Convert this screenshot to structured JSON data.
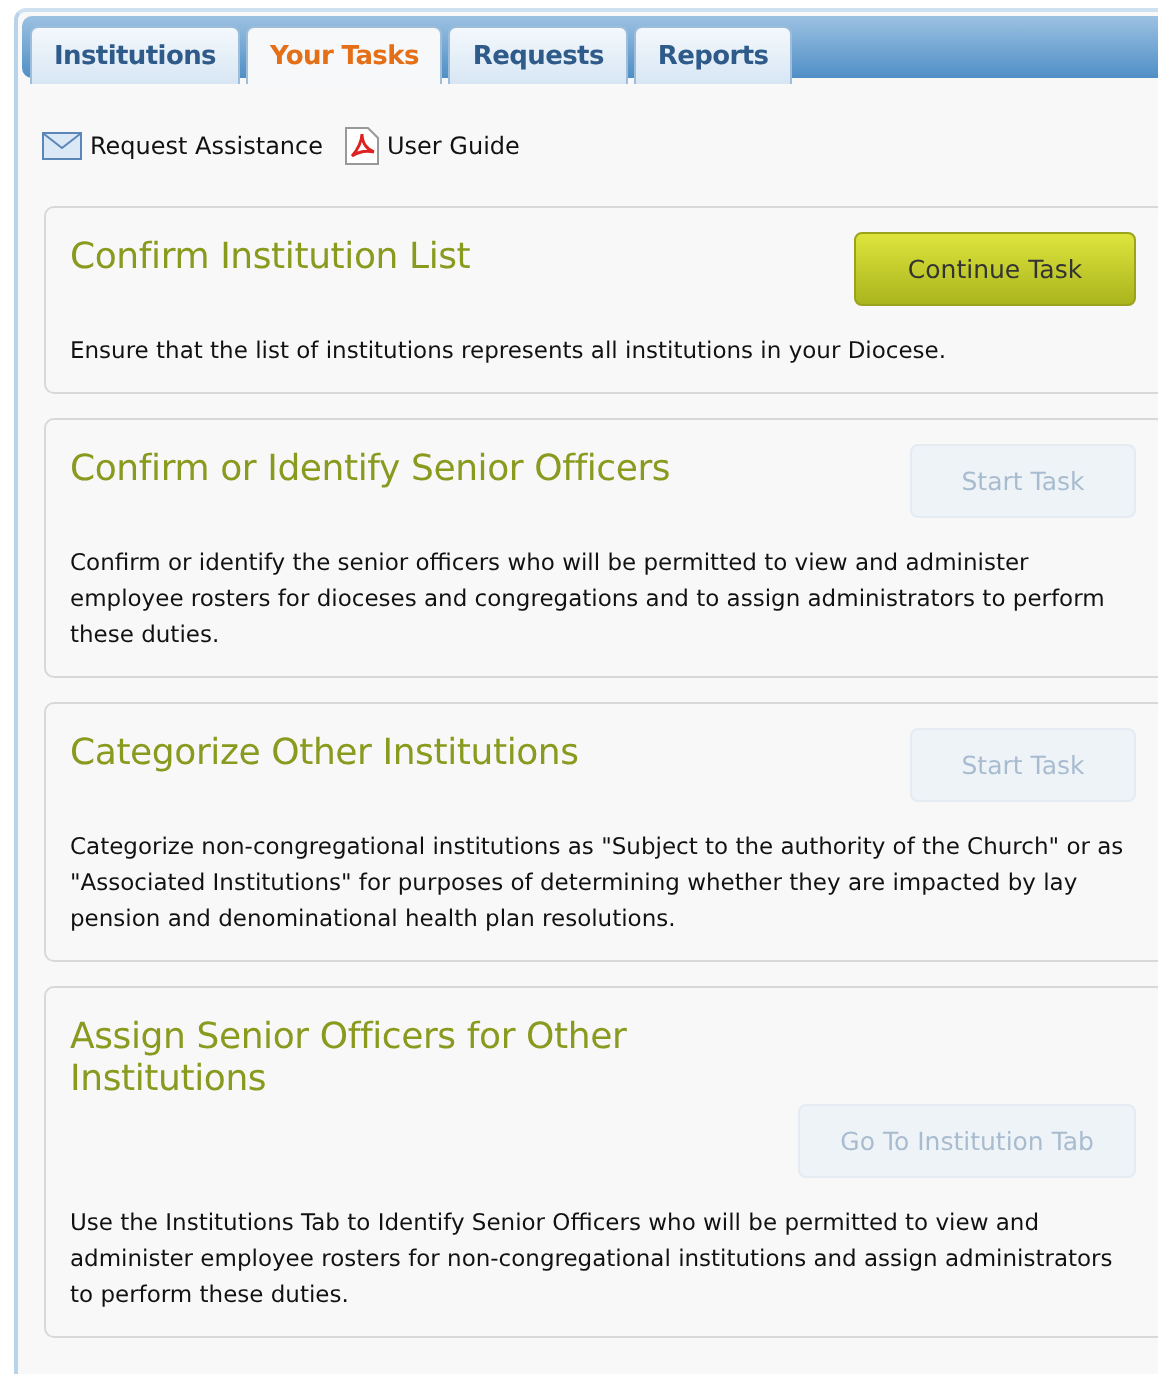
{
  "tabs": [
    {
      "label": "Institutions",
      "selected": false
    },
    {
      "label": "Your Tasks",
      "selected": true
    },
    {
      "label": "Requests",
      "selected": false
    },
    {
      "label": "Reports",
      "selected": false
    }
  ],
  "links": [
    {
      "kind": "mail",
      "label": "Request Assistance"
    },
    {
      "kind": "pdf",
      "label": "User Guide"
    }
  ],
  "tasks": [
    {
      "title": "Confirm Institution List",
      "button": {
        "label": "Continue Task",
        "disabled": false
      },
      "description": "Ensure that the list of institutions represents all institutions in your Diocese."
    },
    {
      "title": "Confirm or Identify Senior Officers",
      "button": {
        "label": "Start Task",
        "disabled": true
      },
      "description": "Confirm or identify the senior officers who will be permitted to view and administer employee rosters for dioceses and congregations and to assign administrators to perform these duties."
    },
    {
      "title": "Categorize Other Institutions",
      "button": {
        "label": "Start Task",
        "disabled": true
      },
      "description": "Categorize non-congregational institutions as \"Subject to the authority of the Church\" or as \"Associated Institutions\" for purposes of determining whether they are impacted by lay pension and denominational health plan resolutions."
    },
    {
      "title": "Assign Senior Officers for Other Institutions",
      "button": {
        "label": "Go To Institution Tab",
        "disabled": true
      },
      "description": "Use the Institutions Tab to Identify Senior Officers who will be permitted to view and administer employee rosters for non-congregational institutions and assign administrators to perform these duties."
    }
  ]
}
